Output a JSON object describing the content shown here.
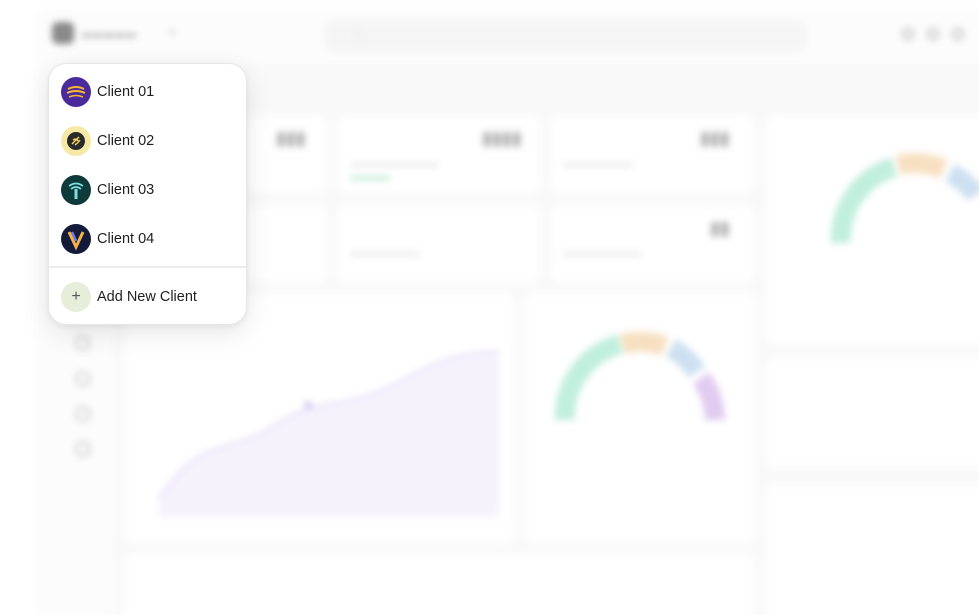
{
  "clients_menu": {
    "items": [
      {
        "label": "Client 01",
        "icon": "client-01-logo-icon",
        "color": "#4b2a9b"
      },
      {
        "label": "Client 02",
        "icon": "client-02-logo-icon",
        "color": "#f6e9a6"
      },
      {
        "label": "Client 03",
        "icon": "client-03-logo-icon",
        "color": "#0f3a3a"
      },
      {
        "label": "Client 04",
        "icon": "client-04-logo-icon",
        "color": "#141a3a"
      }
    ],
    "add_label": "Add New Client",
    "add_icon": "plus-icon"
  }
}
